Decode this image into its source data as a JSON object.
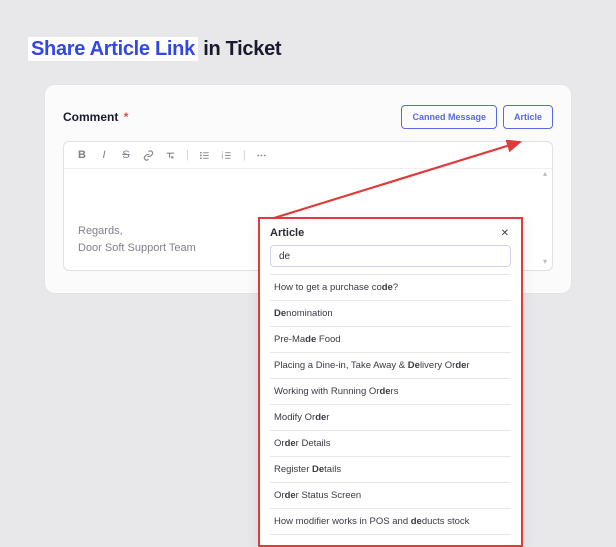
{
  "page": {
    "title_parts": {
      "prefix": "Share Article Link",
      "suffix": "in Ticket"
    }
  },
  "comment_card": {
    "label": "Comment",
    "required_marker": "*",
    "actions": {
      "canned": "Canned Message",
      "article": "Article"
    },
    "toolbar": {
      "bold": "B",
      "italic": "I",
      "strike": "S",
      "link": "link",
      "clear": "clear",
      "ul": "ul",
      "ol": "ol",
      "more": "more"
    },
    "body": {
      "line1": "Regards,",
      "line2": "Door Soft Support Team"
    }
  },
  "article_dropdown": {
    "title": "Article",
    "close": "✕",
    "search_value": "de",
    "items": [
      "How to get a purchase co<b>de</b>?",
      "<b>De</b>nomination",
      "Pre-Ma<b>de</b> Food",
      "Placing a Dine-in, Take Away & <b>De</b>livery Or<b>de</b>r",
      "Working with Running Or<b>de</b>rs",
      "Modify Or<b>de</b>r",
      "Or<b>de</b>r Details",
      "Register <b>De</b>tails",
      "Or<b>de</b>r Status Screen",
      "How modifier works in POS and <b>de</b>ducts stock"
    ]
  }
}
